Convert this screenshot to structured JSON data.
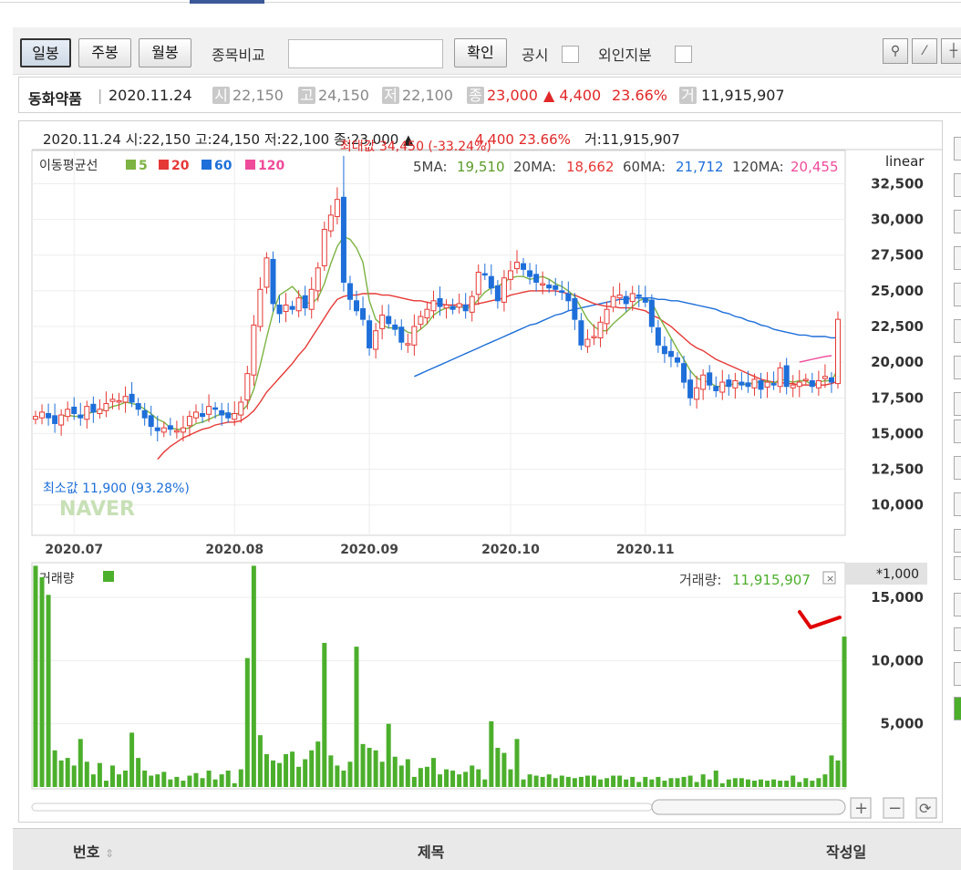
{
  "toolbar": {
    "btn_daily": "일봉",
    "btn_weekly": "주봉",
    "btn_monthly": "월봉",
    "compare_label": "종목비교",
    "confirm": "확인",
    "disclosure": "공시",
    "foreign": "외인지분"
  },
  "info": {
    "name": "동화약품",
    "date": "2020.11.24",
    "open_tag": "시",
    "open": "22,150",
    "high_tag": "고",
    "high": "24,150",
    "low_tag": "저",
    "low": "22,100",
    "close_tag": "종",
    "close": "23,000",
    "change": "▲ 4,400",
    "change_pct": "23.66%",
    "vol_tag": "거",
    "volume": "11,915,907"
  },
  "chart": {
    "header_line": "2020.11.24 시:22,150 고:24,150 저:22,100 종:23,000 ▲",
    "header_change": "4,400  23.66%",
    "header_volume": "거:11,915,907",
    "ma_legend_title": "이동평균선",
    "ma5": "5",
    "ma20": "20",
    "ma60": "60",
    "ma120": "120",
    "ma5_label": "5MA:",
    "ma5_val": "19,510",
    "ma20_label": "20MA:",
    "ma20_val": "18,662",
    "ma60_label": "60MA:",
    "ma60_val": "21,712",
    "ma120_label": "120MA:",
    "ma120_val": "20,455",
    "scale": "linear",
    "max_note": "최대값 34,450 (-33.24%)",
    "min_note": "최소값 11,900 (93.28%)",
    "watermark": "NAVER",
    "volume_title": "거래량",
    "volume_header_label": "거래량:",
    "volume_header_val": "11,915,907",
    "volume_unit": "*1,000",
    "colors": {
      "ma5": "#7cb342",
      "ma20": "#e53935",
      "ma60": "#1e6fd9",
      "ma120": "#ef4b9b",
      "up": "#e53935",
      "down": "#1e6fd9",
      "volume": "#4caf2c"
    }
  },
  "chart_data": [
    {
      "type": "candlestick",
      "title": "",
      "y_ticks": [
        10000,
        12500,
        15000,
        17500,
        20000,
        22500,
        25000,
        27500,
        30000,
        32500
      ],
      "y_tick_labels": [
        "10,000",
        "12,500",
        "15,000",
        "17,500",
        "20,000",
        "22,500",
        "25,000",
        "27,500",
        "30,000",
        "32,500"
      ],
      "x_tick_labels": [
        "2020.07",
        "2020.08",
        "2020.09",
        "2020.10",
        "2020.11"
      ],
      "ylim": [
        8000,
        34700
      ],
      "close": [
        16200,
        16500,
        16100,
        15700,
        16300,
        16700,
        16400,
        16100,
        16900,
        16500,
        16700,
        17100,
        17400,
        17300,
        17600,
        17200,
        16700,
        16100,
        15500,
        15200,
        15400,
        15300,
        15200,
        15400,
        16200,
        16500,
        16200,
        16900,
        16700,
        16300,
        16100,
        16400,
        17200,
        19200,
        22600,
        25100,
        27300,
        24100,
        23400,
        24000,
        23700,
        24500,
        23800,
        25100,
        26600,
        29300,
        30300,
        31400,
        25600,
        24400,
        23600,
        23000,
        21000,
        22200,
        23300,
        22700,
        22300,
        21400,
        21300,
        22500,
        23200,
        23700,
        24300,
        23900,
        24000,
        23700,
        24100,
        23600,
        24600,
        26300,
        26100,
        25200,
        24300,
        25900,
        26400,
        27000,
        26500,
        26000,
        25600,
        25500,
        25200,
        25100,
        24900,
        24300,
        23000,
        21200,
        21600,
        21800,
        22800,
        23700,
        24600,
        24700,
        24100,
        24800,
        24600,
        24200,
        22500,
        21200,
        20600,
        20400,
        20000,
        18600,
        17500,
        18200,
        19100,
        18400,
        18000,
        18600,
        18300,
        18700,
        18400,
        18300,
        18800,
        18100,
        18600,
        18400,
        19600,
        18300,
        18400,
        18600,
        18800,
        18300,
        18700,
        19000,
        18600,
        23000
      ],
      "volume": [
        17500,
        16600,
        15200,
        2900,
        2100,
        2300,
        1700,
        3800,
        2000,
        1000,
        1900,
        500,
        1700,
        1000,
        1300,
        4300,
        2300,
        1300,
        900,
        1000,
        1200,
        600,
        800,
        500,
        900,
        1100,
        700,
        1300,
        600,
        1000,
        1300,
        300,
        1400,
        10200,
        17500,
        4100,
        2600,
        2100,
        1900,
        2600,
        2800,
        1600,
        2200,
        2900,
        3600,
        11400,
        2500,
        1700,
        1300,
        2000,
        11100,
        3400,
        3100,
        2900,
        2000,
        5000,
        2400,
        1700,
        2200,
        800,
        1500,
        1600,
        2300,
        1000,
        1400,
        1300,
        1000,
        1200,
        1700,
        1400,
        600,
        5200,
        3100,
        2700,
        1400,
        3800,
        600,
        1000,
        900,
        800,
        1000,
        700,
        900,
        800,
        700,
        800,
        900,
        900,
        600,
        700,
        900,
        900,
        600,
        800,
        400,
        800,
        600,
        800,
        500,
        700,
        700,
        800,
        900,
        400,
        1000,
        600,
        1300,
        300,
        600,
        700,
        700,
        600,
        500,
        600,
        500,
        600,
        500,
        500,
        900,
        400,
        700,
        500,
        700,
        1000,
        2500,
        2100,
        11900
      ],
      "ma5": [
        null,
        null,
        null,
        null,
        16200,
        16300,
        16200,
        16200,
        16400,
        16500,
        16600,
        16700,
        16900,
        17000,
        17200,
        17100,
        17000,
        16700,
        16400,
        16000,
        15800,
        15400,
        15300,
        15300,
        15400,
        15700,
        15800,
        16000,
        16200,
        16400,
        16400,
        16300,
        16500,
        17000,
        18100,
        19800,
        21700,
        23500,
        24700,
        25000,
        25300,
        24800,
        24200,
        24100,
        24500,
        25500,
        26900,
        28100,
        28800,
        28600,
        28000,
        27000,
        24300,
        23000,
        22600,
        22400,
        22400,
        22400,
        22100,
        22000,
        22300,
        22700,
        23300,
        23600,
        23800,
        23800,
        23900,
        23800,
        23900,
        24400,
        24900,
        25200,
        25300,
        25600,
        25900,
        26000,
        26000,
        25800,
        25900,
        26000,
        25800,
        25500,
        25300,
        25000,
        24600,
        23800,
        23000,
        22500,
        22200,
        22200,
        22700,
        23100,
        23500,
        23900,
        24300,
        24500,
        24200,
        23300,
        22500,
        21700,
        20900,
        20200,
        19400,
        18900,
        18700,
        18600,
        18300,
        18300,
        18400,
        18500,
        18500,
        18400,
        18600,
        18600,
        18700,
        18500,
        18800,
        18700,
        18600,
        18700,
        18700,
        18400,
        18600,
        18700,
        18700,
        19500
      ],
      "ma20": [
        null,
        null,
        null,
        null,
        null,
        null,
        null,
        null,
        null,
        null,
        null,
        null,
        null,
        null,
        null,
        null,
        null,
        null,
        null,
        13200,
        13700,
        14100,
        14400,
        14700,
        14900,
        15100,
        15300,
        15400,
        15600,
        15700,
        15800,
        15800,
        15900,
        16200,
        16600,
        17200,
        17900,
        18400,
        18900,
        19400,
        19900,
        20500,
        21000,
        21700,
        22400,
        23100,
        23800,
        24400,
        24600,
        24700,
        24700,
        24800,
        24800,
        24800,
        24700,
        24700,
        24600,
        24500,
        24400,
        24300,
        24300,
        24200,
        24100,
        24100,
        24000,
        24000,
        24000,
        24000,
        24000,
        24100,
        24200,
        24300,
        24400,
        24500,
        24700,
        24800,
        24900,
        25000,
        25000,
        25000,
        25000,
        25000,
        24900,
        24800,
        24700,
        24500,
        24300,
        24100,
        24000,
        23900,
        23900,
        23800,
        23800,
        23800,
        23700,
        23600,
        23300,
        23100,
        22800,
        22500,
        22100,
        21700,
        21300,
        21000,
        20800,
        20500,
        20200,
        20000,
        19800,
        19600,
        19400,
        19200,
        19000,
        18800,
        18700,
        18600,
        18600,
        18500,
        18500,
        18400,
        18400,
        18400,
        18400,
        18400,
        18500,
        18662
      ],
      "ma60": [
        null,
        null,
        null,
        null,
        null,
        null,
        null,
        null,
        null,
        null,
        null,
        null,
        null,
        null,
        null,
        null,
        null,
        null,
        null,
        null,
        null,
        null,
        null,
        null,
        null,
        null,
        null,
        null,
        null,
        null,
        null,
        null,
        null,
        null,
        null,
        null,
        null,
        null,
        null,
        null,
        null,
        null,
        null,
        null,
        null,
        null,
        null,
        null,
        null,
        null,
        null,
        null,
        null,
        null,
        null,
        null,
        null,
        null,
        null,
        19000,
        19200,
        19400,
        19600,
        19800,
        20000,
        20200,
        20400,
        20600,
        20800,
        21000,
        21200,
        21400,
        21600,
        21800,
        22000,
        22200,
        22400,
        22600,
        22700,
        22900,
        23100,
        23300,
        23400,
        23600,
        23700,
        23800,
        23900,
        24000,
        24100,
        24200,
        24300,
        24400,
        24400,
        24500,
        24500,
        24500,
        24500,
        24400,
        24400,
        24300,
        24300,
        24200,
        24100,
        24000,
        23900,
        23800,
        23700,
        23500,
        23400,
        23200,
        23100,
        22900,
        22800,
        22600,
        22500,
        22300,
        22200,
        22100,
        22000,
        21900,
        21900,
        21800,
        21800,
        21800,
        21700,
        21712
      ],
      "ma120": [
        null,
        null,
        null,
        null,
        null,
        null,
        null,
        null,
        null,
        null,
        null,
        null,
        null,
        null,
        null,
        null,
        null,
        null,
        null,
        null,
        null,
        null,
        null,
        null,
        null,
        null,
        null,
        null,
        null,
        null,
        null,
        null,
        null,
        null,
        null,
        null,
        null,
        null,
        null,
        null,
        null,
        null,
        null,
        null,
        null,
        null,
        null,
        null,
        null,
        null,
        null,
        null,
        null,
        null,
        null,
        null,
        null,
        null,
        null,
        null,
        null,
        null,
        null,
        null,
        null,
        null,
        null,
        null,
        null,
        null,
        null,
        null,
        null,
        null,
        null,
        null,
        null,
        null,
        null,
        null,
        null,
        null,
        null,
        null,
        null,
        null,
        null,
        null,
        null,
        null,
        null,
        null,
        null,
        null,
        null,
        null,
        null,
        null,
        null,
        null,
        null,
        null,
        null,
        null,
        null,
        null,
        null,
        null,
        null,
        null,
        null,
        null,
        null,
        null,
        null,
        null,
        null,
        null,
        null,
        20000,
        20100,
        20200,
        20300,
        20400,
        20455
      ],
      "max": 34450,
      "min": 11900
    },
    {
      "type": "bar",
      "title": "거래량",
      "y_ticks": [
        5000,
        10000,
        15000
      ],
      "y_tick_labels": [
        "5,000",
        "10,000",
        "15,000"
      ],
      "ylim": [
        0,
        17600
      ]
    }
  ]
}
